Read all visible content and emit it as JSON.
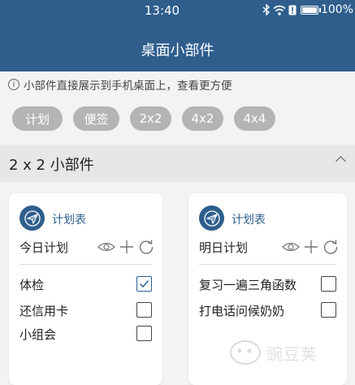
{
  "status_bar": {
    "time": "13:40",
    "battery_percent": "100%",
    "battery_level": 1.0
  },
  "header": {
    "title": "桌面小部件"
  },
  "info": {
    "text": "小部件直接展示到手机桌面上，查看更方便",
    "icon": "info-icon"
  },
  "tags": [
    {
      "label": "计划"
    },
    {
      "label": "便签"
    },
    {
      "label": "2x2"
    },
    {
      "label": "4x2"
    },
    {
      "label": "4x4"
    }
  ],
  "section": {
    "title": "2 x 2 小部件",
    "collapse_icon": "chevron-up-icon"
  },
  "cards": [
    {
      "app_name": "计划表",
      "subtitle": "今日计划",
      "items": [
        {
          "text": "体检",
          "checked": true
        },
        {
          "text": "还信用卡",
          "checked": false
        },
        {
          "text": "小组会",
          "checked": false
        }
      ]
    },
    {
      "app_name": "计划表",
      "subtitle": "明日计划",
      "items": [
        {
          "text": "复习一遍三角函数",
          "checked": false
        },
        {
          "text": "打电话问候奶奶",
          "checked": false
        }
      ]
    }
  ],
  "watermark": {
    "text": "豌豆荚"
  },
  "colors": {
    "primary": "#2f5e8d",
    "tag_bg": "#b4b4b4",
    "section_bg": "#e7e7e7",
    "page_bg": "#f3f3f3"
  }
}
